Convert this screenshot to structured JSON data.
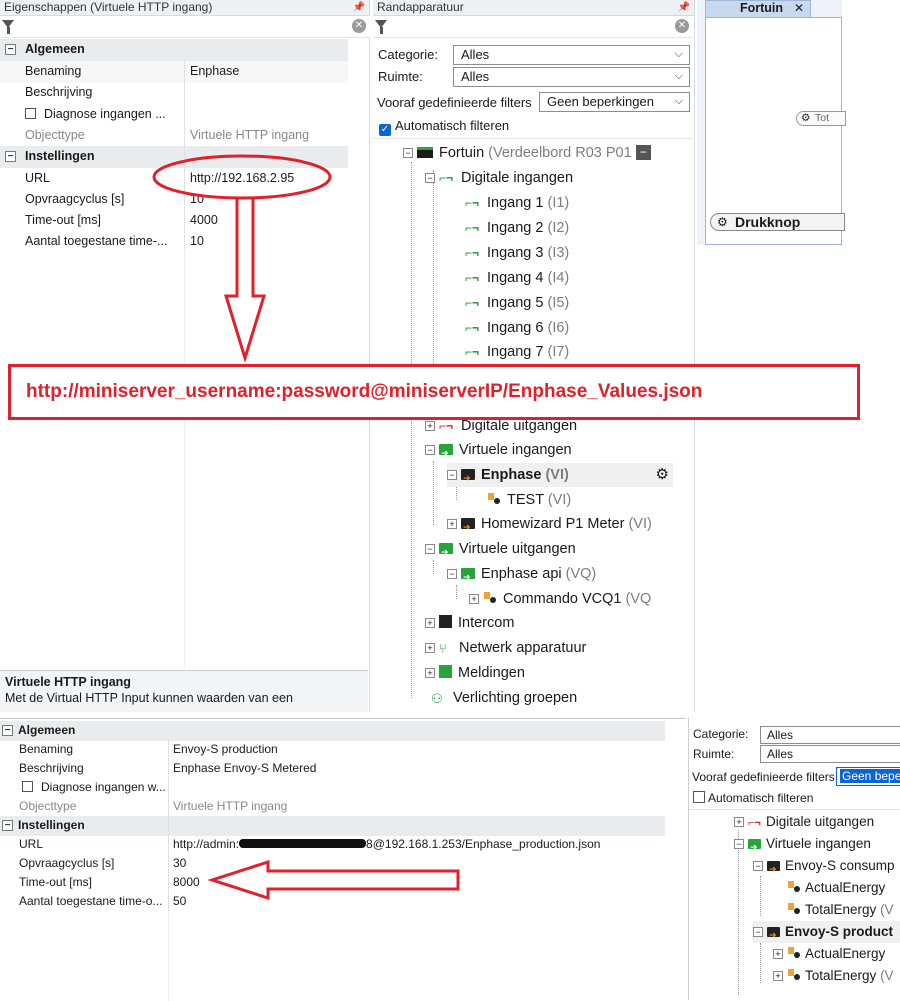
{
  "left_panel": {
    "title": "Eigenschappen (Virtuele HTTP ingang)",
    "groups": [
      {
        "label": "Algemeen"
      },
      {
        "label": "Instellingen"
      }
    ],
    "rows": {
      "benaming": {
        "key": "Benaming",
        "value": "Enphase"
      },
      "beschrijving": {
        "key": "Beschrijving",
        "value": ""
      },
      "diagnose": {
        "key": "Diagnose ingangen ..."
      },
      "objecttype": {
        "key": "Objecttype",
        "value": "Virtuele HTTP ingang"
      },
      "url": {
        "key": "URL",
        "value": "http://192.168.2.95"
      },
      "opvraag": {
        "key": "Opvraagcyclus [s]",
        "value": "10"
      },
      "timeout": {
        "key": "Time-out [ms]",
        "value": "4000"
      },
      "aantal": {
        "key": "Aantal toegestane time-...",
        "value": "10"
      }
    },
    "help_title": "Virtuele HTTP ingang",
    "help_text": "Met de Virtual HTTP Input kunnen waarden van een"
  },
  "mid_panel": {
    "title": "Randapparatuur",
    "categorie_label": "Categorie:",
    "categorie_value": "Alles",
    "ruimte_label": "Ruimte:",
    "ruimte_value": "Alles",
    "filters_label": "Vooraf gedefinieerde filters",
    "filters_value": "Geen beperkingen",
    "auto_label": "Automatisch filteren",
    "tree": {
      "fortuin": "Fortuin",
      "fortuin_sfx": "(Verdeelbord R03 P01",
      "digitale_ingangen": "Digitale ingangen",
      "ingang1": "Ingang 1",
      "ingang1_sfx": "(I1)",
      "ingang2": "Ingang 2",
      "ingang2_sfx": "(I2)",
      "ingang3": "Ingang 3",
      "ingang3_sfx": "(I3)",
      "ingang4": "Ingang 4",
      "ingang4_sfx": "(I4)",
      "ingang5": "Ingang 5",
      "ingang5_sfx": "(I5)",
      "ingang6": "Ingang 6",
      "ingang6_sfx": "(I6)",
      "ingang7": "Ingang 7",
      "ingang7_sfx": "(I7)",
      "digitale_uitgangen": "Digitale uitgangen",
      "virtuele_ingangen": "Virtuele ingangen",
      "enphase": "Enphase",
      "enphase_sfx": "(VI)",
      "test": "TEST",
      "test_sfx": "(VI)",
      "homewizard": "Homewizard P1 Meter",
      "homewizard_sfx": "(VI)",
      "virtuele_uitgangen": "Virtuele uitgangen",
      "enphase_api": "Enphase api",
      "enphase_api_sfx": "(VQ)",
      "commando": "Commando VCQ1",
      "commando_sfx": "(VQ",
      "intercom": "Intercom",
      "netwerk": "Netwerk apparatuur",
      "meldingen": "Meldingen",
      "verlichting": "Verlichting groepen"
    }
  },
  "right_panel": {
    "tab_label": "Fortuin",
    "block1": "Tot",
    "block2": "Drukknop"
  },
  "annotation": {
    "text": "http://miniserver_username:password@miniserverIP/Enphase_Values.json",
    "color": "#e0202a"
  },
  "bottom_left": {
    "groups": [
      {
        "label": "Algemeen"
      },
      {
        "label": "Instellingen"
      }
    ],
    "rows": {
      "benaming": {
        "key": "Benaming",
        "value": "Envoy-S production"
      },
      "beschrijving": {
        "key": "Beschrijving",
        "value": "Enphase Envoy-S Metered"
      },
      "diagnose": {
        "key": "Diagnose ingangen w..."
      },
      "objecttype": {
        "key": "Objecttype",
        "value": "Virtuele HTTP ingang"
      },
      "url": {
        "key": "URL",
        "value_start": "http://admin:",
        "value_end": "8@192.168.1.253/Enphase_production.json"
      },
      "opvraag": {
        "key": "Opvraagcyclus [s]",
        "value": "30"
      },
      "timeout": {
        "key": "Time-out [ms]",
        "value": "8000"
      },
      "aantal": {
        "key": "Aantal toegestane time-o...",
        "value": "50"
      }
    }
  },
  "bottom_right": {
    "categorie_label": "Categorie:",
    "categorie_value": "Alles",
    "ruimte_label": "Ruimte:",
    "ruimte_value": "Alles",
    "filters_label": "Vooraf gedefinieerde filters",
    "filters_value": "Geen beper",
    "auto_label": "Automatisch filteren",
    "tree": {
      "digitale_uitgangen": "Digitale uitgangen",
      "virtuele_ingangen": "Virtuele ingangen",
      "envoy_consump": "Envoy-S consump",
      "actual1": "ActualEnergy",
      "total1": "TotalEnergy",
      "total1_sfx": "(V",
      "envoy_product": "Envoy-S product",
      "actual2": "ActualEnergy",
      "total2": "TotalEnergy",
      "total2_sfx": "(V"
    }
  }
}
